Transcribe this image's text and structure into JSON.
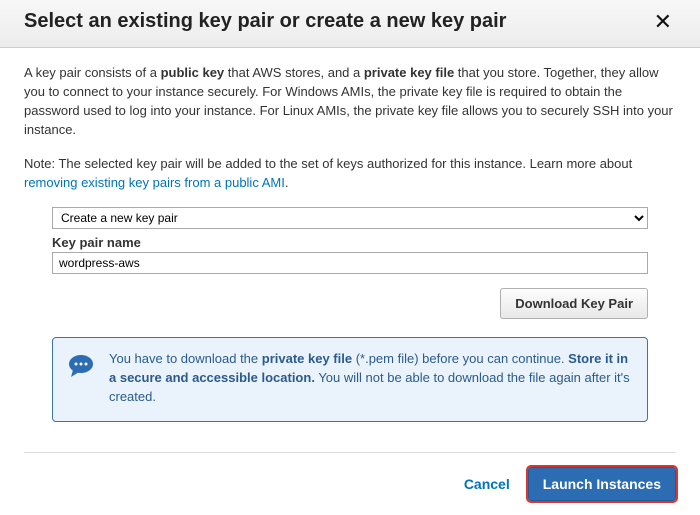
{
  "modal": {
    "title": "Select an existing key pair or create a new key pair"
  },
  "intro": {
    "part1": "A key pair consists of a ",
    "bold1": "public key",
    "part2": " that AWS stores, and a ",
    "bold2": "private key file",
    "part3": " that you store. Together, they allow you to connect to your instance securely. For Windows AMIs, the private key file is required to obtain the password used to log into your instance. For Linux AMIs, the private key file allows you to securely SSH into your instance."
  },
  "note": {
    "text": "Note: The selected key pair will be added to the set of keys authorized for this instance. Learn more about ",
    "link": "removing existing key pairs from a public AMI",
    "tail": "."
  },
  "form": {
    "select_value": "Create a new key pair",
    "keyname_label": "Key pair name",
    "keyname_value": "wordpress-aws",
    "download_label": "Download Key Pair"
  },
  "alert": {
    "part1": "You have to download the ",
    "bold1": "private key file",
    "part2": " (*.pem file) before you can continue. ",
    "bold2": "Store it in a secure and accessible location.",
    "part3": " You will not be able to download the file again after it's created."
  },
  "footer": {
    "cancel": "Cancel",
    "launch": "Launch Instances"
  }
}
